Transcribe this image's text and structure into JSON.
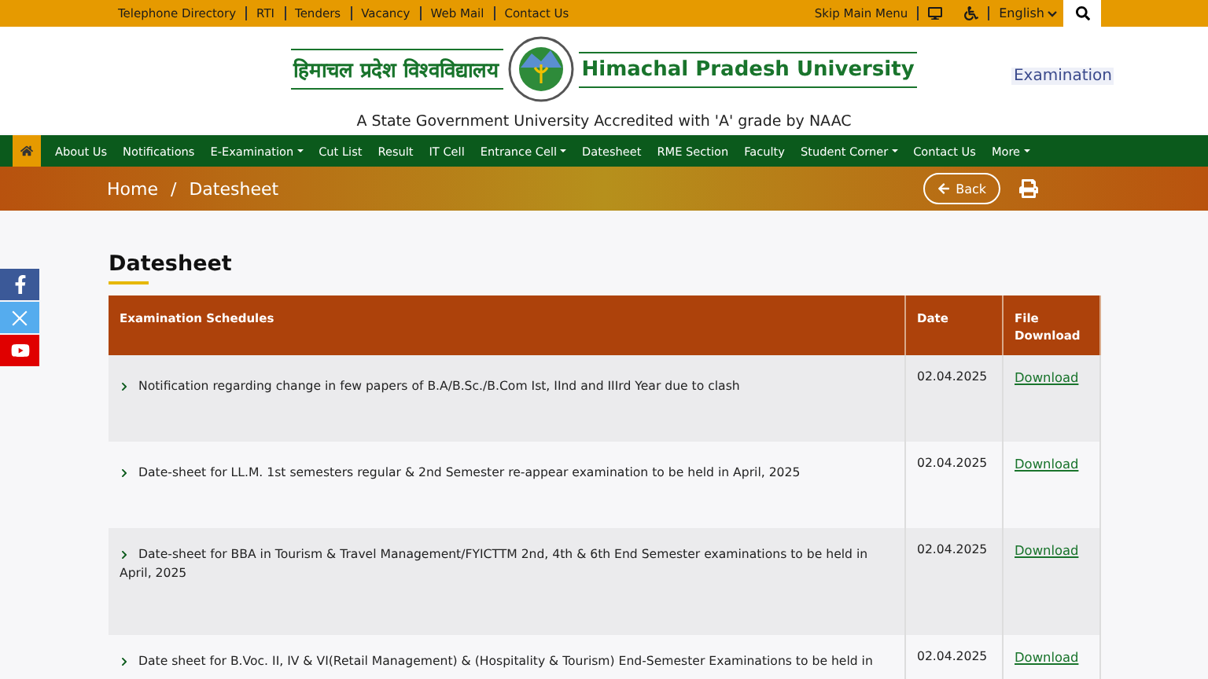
{
  "top_links": [
    "Telephone Directory",
    "RTI",
    "Tenders",
    "Vacancy",
    "Web Mail",
    "Contact Us"
  ],
  "skip_menu": "Skip Main Menu",
  "language": "English",
  "header": {
    "hindi_name": "हिमाचल प्रदेश विश्वविद्यालय",
    "english_name": "Himachal Pradesh University",
    "tagline": "A State Government University Accredited with 'A' grade by NAAC",
    "section": "Examination"
  },
  "nav": [
    {
      "label": "About Us",
      "dropdown": false
    },
    {
      "label": "Notifications",
      "dropdown": false
    },
    {
      "label": "E-Examination",
      "dropdown": true
    },
    {
      "label": "Cut List",
      "dropdown": false
    },
    {
      "label": "Result",
      "dropdown": false
    },
    {
      "label": "IT Cell",
      "dropdown": false
    },
    {
      "label": "Entrance Cell",
      "dropdown": true
    },
    {
      "label": "Datesheet",
      "dropdown": false
    },
    {
      "label": "RME Section",
      "dropdown": false
    },
    {
      "label": "Faculty",
      "dropdown": false
    },
    {
      "label": "Student Corner",
      "dropdown": true
    },
    {
      "label": "Contact Us",
      "dropdown": false
    },
    {
      "label": "More",
      "dropdown": true
    }
  ],
  "breadcrumb": [
    "Home",
    "Datesheet"
  ],
  "breadcrumb_separator": "/",
  "back_button": "Back",
  "page_title": "Datesheet",
  "table": {
    "columns": [
      "Examination Schedules",
      "Date",
      "File Download"
    ],
    "rows": [
      {
        "title": "Notification regarding change in few papers of B.A/B.Sc./B.Com Ist, IInd and IIIrd Year due to clash",
        "date": "02.04.2025",
        "link": "Download"
      },
      {
        "title": "Date-sheet for LL.M. 1st semesters regular & 2nd Semester re-appear examination to be held in April, 2025",
        "date": "02.04.2025",
        "link": "Download"
      },
      {
        "title": "Date-sheet for BBA in Tourism & Travel Management/FYICTTM 2nd, 4th & 6th End Semester examinations to be held in April, 2025",
        "date": "02.04.2025",
        "link": "Download"
      },
      {
        "title": "Date sheet for B.Voc. II, IV & VI(Retail Management) & (Hospitality & Tourism) End-Semester Examinations to be held in",
        "date": "02.04.2025",
        "link": "Download"
      }
    ]
  }
}
